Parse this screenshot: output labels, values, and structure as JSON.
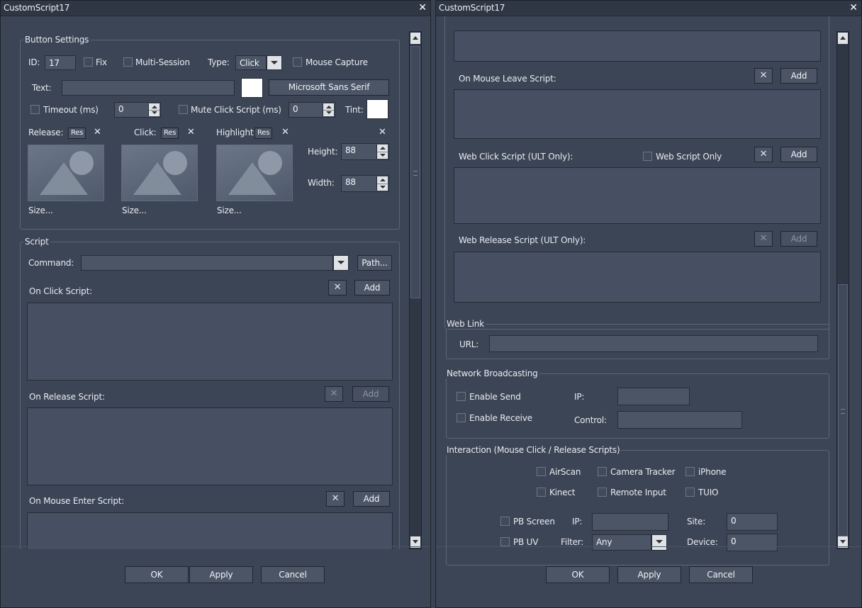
{
  "left": {
    "title": "CustomScript17",
    "button_settings": {
      "legend": "Button Settings",
      "id_label": "ID:",
      "id_value": "17",
      "fix": "Fix",
      "multi_session": "Multi-Session",
      "type_label": "Type:",
      "type_value": "Click",
      "mouse_capture": "Mouse Capture",
      "text_label": "Text:",
      "text_value": "",
      "font_button": "Microsoft Sans Serif",
      "timeout_label": "Timeout (ms)",
      "timeout_value": "0",
      "mute_label": "Mute Click Script (ms)",
      "mute_value": "0",
      "tint_label": "Tint:",
      "release_label": "Release:",
      "click_label": "Click:",
      "highlight_label": "Highlight:",
      "res_label": "Res",
      "x_glyph": "✕",
      "height_label": "Height:",
      "height_value": "88",
      "width_label": "Width:",
      "width_value": "88",
      "size_label": "Size..."
    },
    "script": {
      "legend": "Script",
      "command_label": "Command:",
      "command_value": "",
      "path_button": "Path...",
      "on_click": "On Click Script:",
      "on_release": "On Release Script:",
      "on_mouse_enter": "On Mouse Enter Script:",
      "add": "Add",
      "x": "✕"
    },
    "footer": {
      "ok": "OK",
      "apply": "Apply",
      "cancel": "Cancel"
    }
  },
  "right": {
    "title": "CustomScript17",
    "on_mouse_leave": "On Mouse Leave Script:",
    "web_click": "Web Click Script (ULT Only):",
    "web_script_only": "Web Script Only",
    "web_release": "Web Release Script (ULT Only):",
    "add": "Add",
    "x": "✕",
    "web_link": {
      "legend": "Web Link",
      "url_label": "URL:",
      "url_value": ""
    },
    "network": {
      "legend": "Network Broadcasting",
      "enable_send": "Enable Send",
      "enable_receive": "Enable Receive",
      "ip_label": "IP:",
      "ip_value": "",
      "control_label": "Control:",
      "control_value": ""
    },
    "interaction": {
      "legend": "Interaction (Mouse Click / Release Scripts)",
      "airscan": "AirScan",
      "camera_tracker": "Camera Tracker",
      "iphone": "iPhone",
      "kinect": "Kinect",
      "remote_input": "Remote Input",
      "tuio": "TUIO",
      "pb_screen": "PB Screen",
      "ip_label": "IP:",
      "ip_value": "",
      "site_label": "Site:",
      "site_value": "0",
      "pb_uv": "PB UV",
      "filter_label": "Filter:",
      "filter_value": "Any",
      "device_label": "Device:",
      "device_value": "0"
    },
    "footer": {
      "ok": "OK",
      "apply": "Apply",
      "cancel": "Cancel"
    }
  },
  "icons": {
    "close": "close-icon",
    "image": "image-placeholder-icon",
    "dropdown": "chevron-down-icon"
  }
}
